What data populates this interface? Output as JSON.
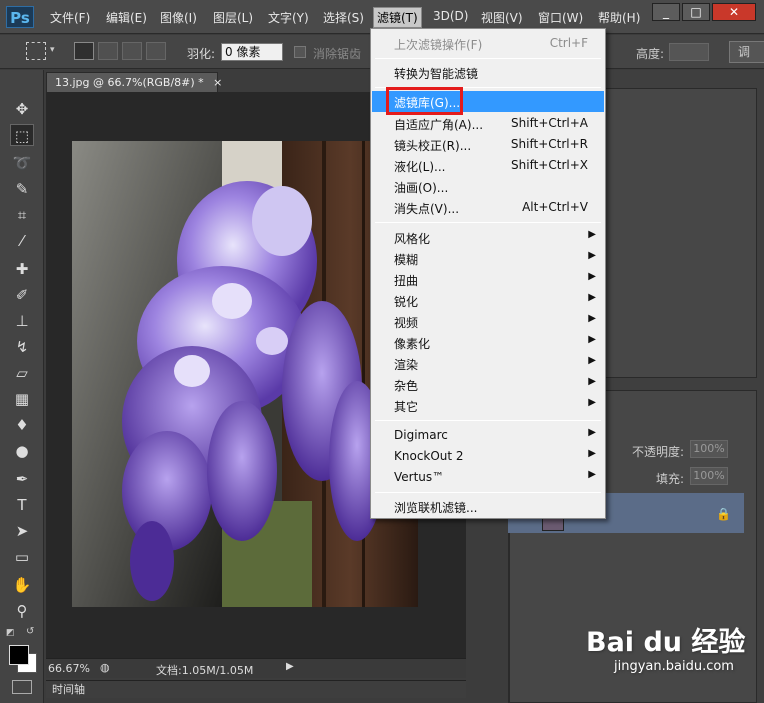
{
  "app": {
    "logo": "Ps",
    "menus": [
      "文件(F)",
      "编辑(E)",
      "图像(I)",
      "图层(L)",
      "文字(Y)",
      "选择(S)",
      "滤镜(T)",
      "3D(D)",
      "视图(V)",
      "窗口(W)",
      "帮助(H)"
    ],
    "active_menu": "滤镜(T)"
  },
  "options": {
    "feather_label": "羽化:",
    "feather_value": "0 像素",
    "antialias_label": "消除锯齿",
    "height_label": "高度:",
    "adjust_edge_label": "调"
  },
  "document": {
    "tab_title": "13.jpg @ 66.7%(RGB/8#) *",
    "tab_close": "×",
    "zoom": "66.67%",
    "doc_info": "文档:1.05M/1.05M",
    "timeline_label": "时间轴"
  },
  "layers": {
    "opacity_label": "不透明度:",
    "opacity_value": "100%",
    "fill_label": "填充:",
    "fill_value": "100%"
  },
  "filter_menu": {
    "items": [
      {
        "label": "上次滤镜操作(F)",
        "shortcut": "Ctrl+F",
        "disabled": true
      },
      {
        "label": "转换为智能滤镜",
        "shortcut": ""
      },
      {
        "label": "滤镜库(G)...",
        "shortcut": "",
        "highlighted": true
      },
      {
        "label": "自适应广角(A)...",
        "shortcut": "Shift+Ctrl+A"
      },
      {
        "label": "镜头校正(R)...",
        "shortcut": "Shift+Ctrl+R"
      },
      {
        "label": "液化(L)...",
        "shortcut": "Shift+Ctrl+X"
      },
      {
        "label": "油画(O)...",
        "shortcut": ""
      },
      {
        "label": "消失点(V)...",
        "shortcut": "Alt+Ctrl+V"
      },
      {
        "label": "风格化",
        "submenu": true
      },
      {
        "label": "模糊",
        "submenu": true
      },
      {
        "label": "扭曲",
        "submenu": true
      },
      {
        "label": "锐化",
        "submenu": true
      },
      {
        "label": "视频",
        "submenu": true
      },
      {
        "label": "像素化",
        "submenu": true
      },
      {
        "label": "渲染",
        "submenu": true
      },
      {
        "label": "杂色",
        "submenu": true
      },
      {
        "label": "其它",
        "submenu": true
      },
      {
        "label": "Digimarc",
        "submenu": true
      },
      {
        "label": "KnockOut 2",
        "submenu": true
      },
      {
        "label": "Vertus™",
        "submenu": true
      },
      {
        "label": "浏览联机滤镜...",
        "shortcut": ""
      }
    ]
  },
  "watermark": {
    "top": "Bai du 经验",
    "bottom": "jingyan.baidu.com"
  },
  "colors": {
    "highlight": "#3399ff",
    "annotation_box": "#e41b1b",
    "ps_blue": "#5bb7ef"
  }
}
